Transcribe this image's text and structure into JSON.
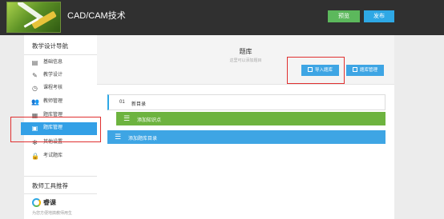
{
  "header": {
    "course_title": "CAD/CAM技术",
    "preview_label": "预览",
    "publish_label": "发布"
  },
  "sidebar": {
    "nav_title": "教学设计导航",
    "items": [
      {
        "label": "基础信息",
        "icon": "document-icon"
      },
      {
        "label": "教学设计",
        "icon": "edit-icon"
      },
      {
        "label": "课程考核",
        "icon": "clock-icon"
      },
      {
        "label": "教师管理",
        "icon": "users-icon"
      },
      {
        "label": "题库管理",
        "icon": "grid-icon"
      },
      {
        "label": "题库管理",
        "icon": "inbox-icon",
        "active": true
      },
      {
        "label": "其他设置",
        "icon": "gear-icon"
      },
      {
        "label": "考试题库",
        "icon": "lock-icon"
      }
    ],
    "tools_title": "教师工具推荐",
    "tool": {
      "name": "睿课",
      "desc": "为您方便地搞教师用生"
    }
  },
  "main": {
    "title": "题库",
    "subtitle": "这里可以添加题目",
    "import_label": "导入题库",
    "manage_label": "题库管理",
    "category": {
      "number": "01",
      "name": "新目录"
    },
    "add_point_label": "添加知识点",
    "add_category_label": "添加题库目录"
  },
  "colors": {
    "header_bg": "#303030",
    "accent_blue": "#3ea5e4",
    "accent_green": "#6db33f",
    "annotation_red": "#e03030"
  }
}
